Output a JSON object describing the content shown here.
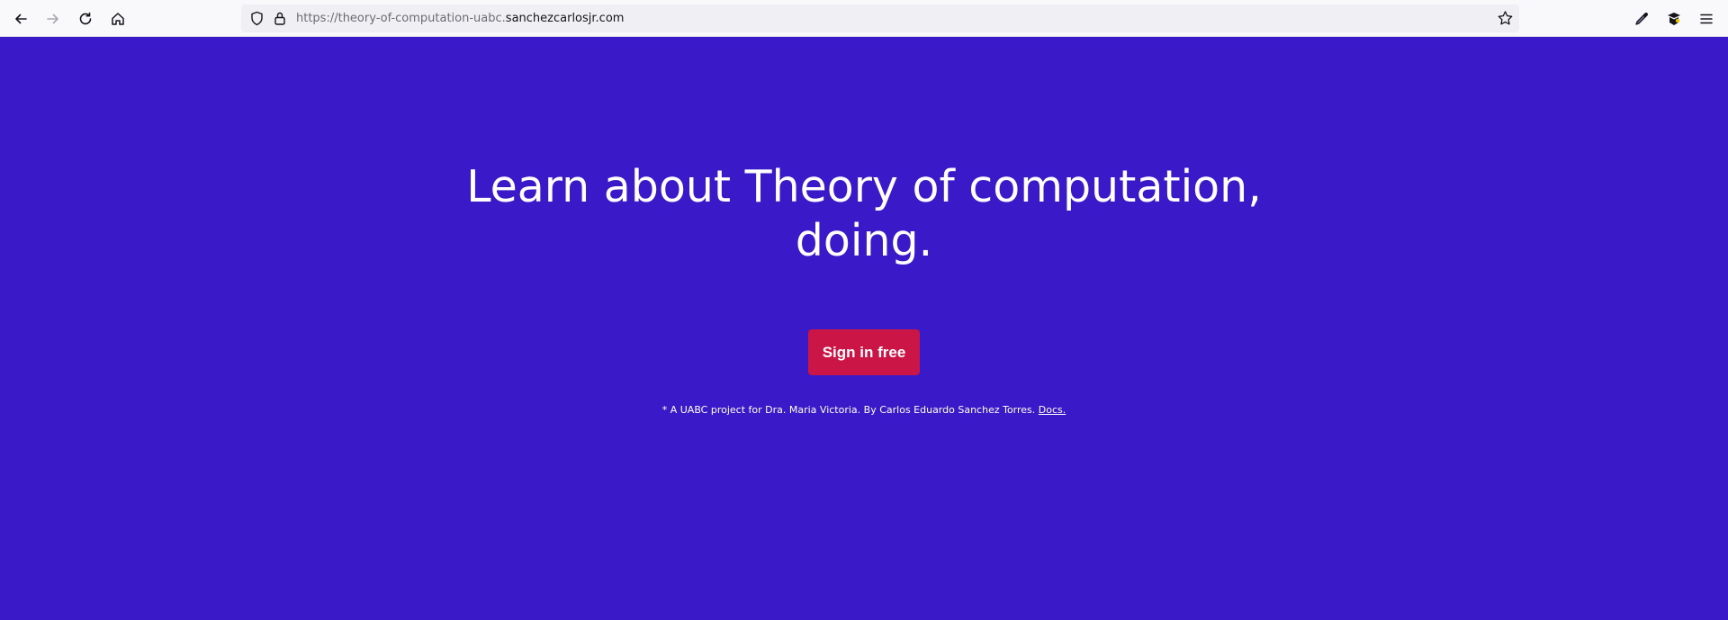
{
  "browser": {
    "url_prefix": "https://theory-of-computation-uabc.",
    "url_domain": "sanchezcarlosjr.com",
    "icons": [
      "back-icon",
      "forward-icon",
      "reload-icon",
      "home-icon",
      "shield-icon",
      "lock-icon",
      "bookmark-star-icon",
      "eyedropper-icon",
      "extension-icon",
      "menu-icon"
    ]
  },
  "hero": {
    "headline_line1": "Learn about Theory of computation,",
    "headline_line2": "doing.",
    "cta_label": "Sign in free",
    "footnote_text": "* A UABC project for Dra. Maria Victoria. By Carlos Eduardo Sanchez Torres.",
    "docs_link": "Docs."
  },
  "colors": {
    "background": "#3a19c8",
    "cta": "#cc1547",
    "text": "#ffffff"
  }
}
